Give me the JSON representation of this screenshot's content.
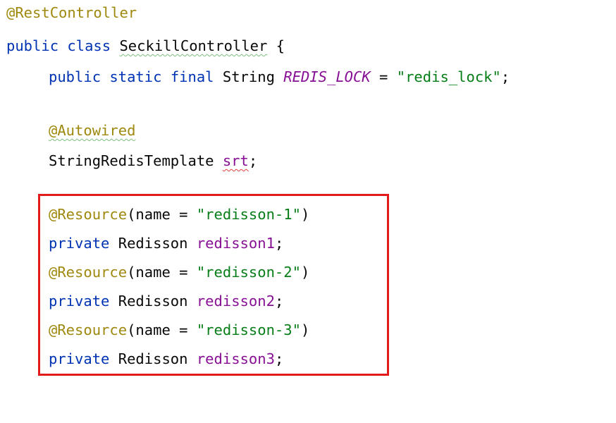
{
  "code": {
    "line1": {
      "annotation": "@RestController"
    },
    "line2": {
      "kw_public": "public",
      "kw_class": "class",
      "class_name": "SeckillController",
      "brace": "{"
    },
    "line3": {
      "kw_public": "public",
      "kw_static": "static",
      "kw_final": "final",
      "type": "String",
      "const_name": "REDIS_LOCK",
      "eq": "=",
      "value": "\"redis_lock\"",
      "semi": ";"
    },
    "line5": {
      "annotation": "@Autowired"
    },
    "line6": {
      "type": "StringRedisTemplate",
      "field": "srt",
      "semi": ";"
    },
    "resources": [
      {
        "annotation": "@Resource",
        "open": "(name = ",
        "value": "\"redisson-1\"",
        "close": ")",
        "kw_private": "private",
        "type": "Redisson",
        "field": "redisson1",
        "semi": ";"
      },
      {
        "annotation": "@Resource",
        "open": "(name = ",
        "value": "\"redisson-2\"",
        "close": ")",
        "kw_private": "private",
        "type": "Redisson",
        "field": "redisson2",
        "semi": ";"
      },
      {
        "annotation": "@Resource",
        "open": "(name = ",
        "value": "\"redisson-3\"",
        "close": ")",
        "kw_private": "private",
        "type": "Redisson",
        "field": "redisson3",
        "semi": ";"
      }
    ]
  },
  "colors": {
    "annotation": "#9e880d",
    "keyword": "#0033b3",
    "string": "#067d17",
    "field": "#871094",
    "highlight_border": "#e31b1b"
  }
}
